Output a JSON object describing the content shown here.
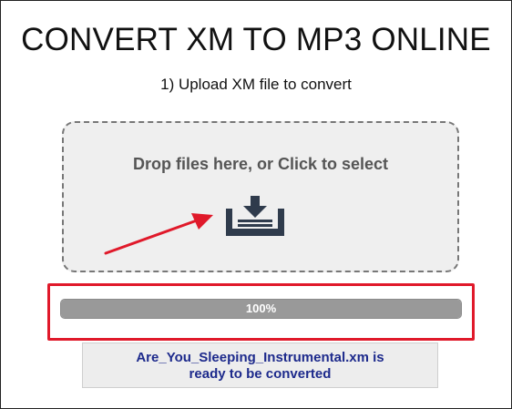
{
  "page": {
    "title": "CONVERT XM TO MP3 ONLINE",
    "step_label": "1) Upload XM file to convert"
  },
  "dropzone": {
    "text": "Drop files here, or Click to select",
    "icon": "upload-tray-icon"
  },
  "progress": {
    "value": 1.0,
    "label": "100%"
  },
  "status": {
    "filename_line": "Are_You_Sleeping_Instrumental.xm is",
    "message_line": "ready to be converted"
  },
  "colors": {
    "annotation_red": "#e0192a",
    "status_text": "#1d2a8c",
    "progress_fill": "#999999",
    "dropzone_bg": "#efefef"
  }
}
